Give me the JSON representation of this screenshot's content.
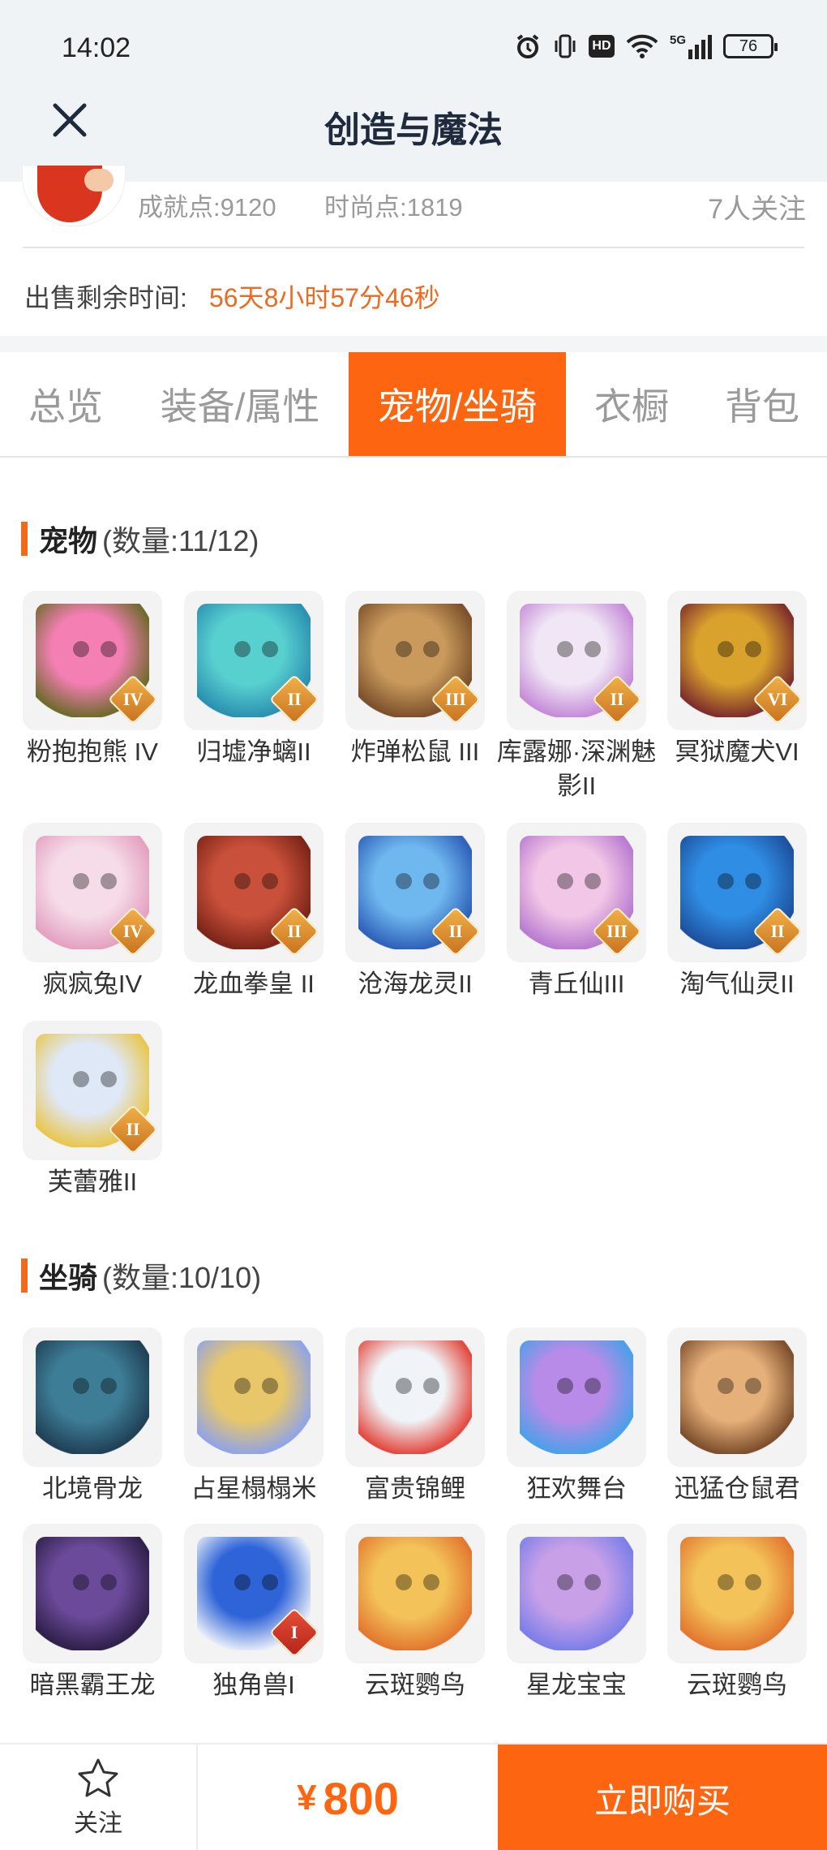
{
  "status_bar": {
    "time": "14:02",
    "network": "5G",
    "hd": "HD",
    "battery": "76"
  },
  "header": {
    "title": "创造与魔法"
  },
  "seller": {
    "achievement": "成就点:9120",
    "fashion": "时尚点:1819",
    "followers": "7人关注",
    "remaining_label": "出售剩余时间:",
    "remaining_value": "56天8小时57分46秒"
  },
  "tabs": [
    {
      "label": "总览"
    },
    {
      "label": "装备/属性"
    },
    {
      "label": "宠物/坐骑",
      "active": true
    },
    {
      "label": "衣橱"
    },
    {
      "label": "背包"
    }
  ],
  "pets": {
    "title": "宠物",
    "count": "(数量:11/12)",
    "items": [
      {
        "name": "粉抱抱熊 IV",
        "badge": "IV",
        "colors": [
          "#f47fb3",
          "#6b6a2a"
        ]
      },
      {
        "name": "归墟净螭II",
        "badge": "II",
        "colors": [
          "#59d0d0",
          "#2a8fb0"
        ]
      },
      {
        "name": "炸弹松鼠 III",
        "badge": "III",
        "colors": [
          "#c99a5c",
          "#7a4e2a"
        ]
      },
      {
        "name": "库露娜·深渊魅影II",
        "badge": "II",
        "colors": [
          "#f0e6f5",
          "#c58ad8"
        ]
      },
      {
        "name": "冥狱魔犬VI",
        "badge": "VI",
        "colors": [
          "#d8a22c",
          "#7b2b2b"
        ]
      },
      {
        "name": "疯疯兔IV",
        "badge": "IV",
        "colors": [
          "#f6dce8",
          "#e3a0c0"
        ]
      },
      {
        "name": "龙血拳皇 II",
        "badge": "II",
        "colors": [
          "#c9503a",
          "#7a2418"
        ]
      },
      {
        "name": "沧海龙灵II",
        "badge": "II",
        "colors": [
          "#6fb7ef",
          "#2d5fb8"
        ]
      },
      {
        "name": "青丘仙III",
        "badge": "III",
        "colors": [
          "#f2c6e6",
          "#b77ad0"
        ]
      },
      {
        "name": "淘气仙灵II",
        "badge": "II",
        "colors": [
          "#2f8de3",
          "#1d4f9e"
        ]
      },
      {
        "name": "芙蕾雅II",
        "badge": "II",
        "colors": [
          "#dfe8f7",
          "#e8c64c"
        ]
      }
    ]
  },
  "mounts": {
    "title": "坐骑",
    "count": "(数量:10/10)",
    "items": [
      {
        "name": "北境骨龙",
        "colors": [
          "#3e7d96",
          "#1f3f55"
        ]
      },
      {
        "name": "占星榻榻米",
        "colors": [
          "#e8c76a",
          "#8fa3e8"
        ]
      },
      {
        "name": "富贵锦鲤",
        "colors": [
          "#f0f4f8",
          "#e2453b"
        ]
      },
      {
        "name": "狂欢舞台",
        "colors": [
          "#b98be8",
          "#4aa0e8"
        ]
      },
      {
        "name": "迅猛仓鼠君",
        "colors": [
          "#e6b07a",
          "#7a4c2a"
        ]
      },
      {
        "name": "暗黑霸王龙",
        "colors": [
          "#6b4a9a",
          "#2e1f48"
        ]
      },
      {
        "name": "独角兽I",
        "badge": "I",
        "colors": [
          "#2e64d8",
          "#e8eef8"
        ]
      },
      {
        "name": "云斑鹦鸟",
        "colors": [
          "#f3c35a",
          "#e2762f"
        ]
      },
      {
        "name": "星龙宝宝",
        "colors": [
          "#c8a0e8",
          "#7a7ee8"
        ]
      },
      {
        "name": "云斑鹦鸟",
        "colors": [
          "#f3c35a",
          "#e2762f"
        ]
      }
    ]
  },
  "bottom_bar": {
    "follow_label": "关注",
    "currency": "¥",
    "price": "800",
    "buy_label": "立即购买"
  },
  "accent_color": "#fe6510"
}
